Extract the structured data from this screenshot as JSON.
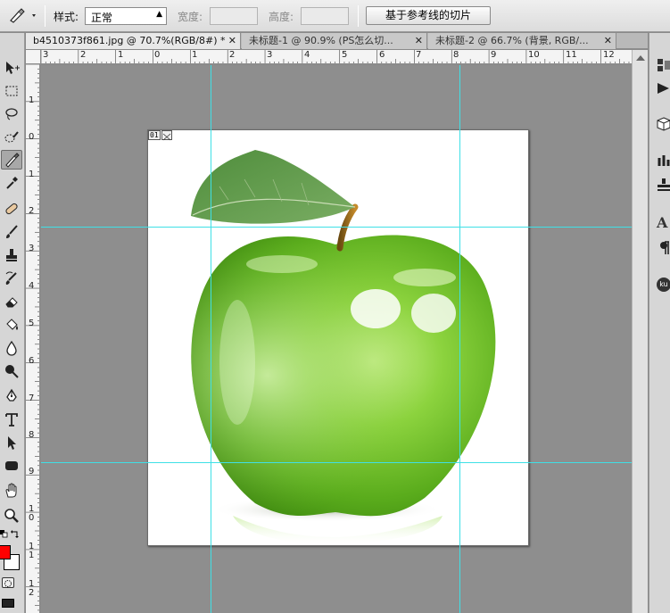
{
  "options_bar": {
    "style_label": "样式:",
    "style_value": "正常",
    "width_label": "宽度:",
    "height_label": "高度:",
    "slice_from_guides_button": "基于参考线的切片"
  },
  "tabs": [
    {
      "label": "b4510373f861.jpg @ 70.7%(RGB/8#) *",
      "active": true
    },
    {
      "label": "未标题-1 @ 90.9% (PS怎么切...",
      "active": false
    },
    {
      "label": "未标题-2 @ 66.7% (背景, RGB/...",
      "active": false
    }
  ],
  "hruler_labels": [
    "3",
    "2",
    "1",
    "0",
    "1",
    "2",
    "3",
    "4",
    "5",
    "6",
    "7",
    "8",
    "9",
    "10",
    "11",
    "12"
  ],
  "vruler_labels": [
    "1",
    "0",
    "1",
    "2",
    "3",
    "4",
    "5",
    "6",
    "7",
    "8",
    "9",
    "10",
    "11",
    "12"
  ],
  "slice_badge": {
    "number": "01"
  },
  "colors": {
    "foreground": "#ff0000",
    "background": "#ffffff",
    "guide": "#3fe0e6"
  },
  "right_panel": {
    "text_tool": "A",
    "badge": "ku"
  }
}
